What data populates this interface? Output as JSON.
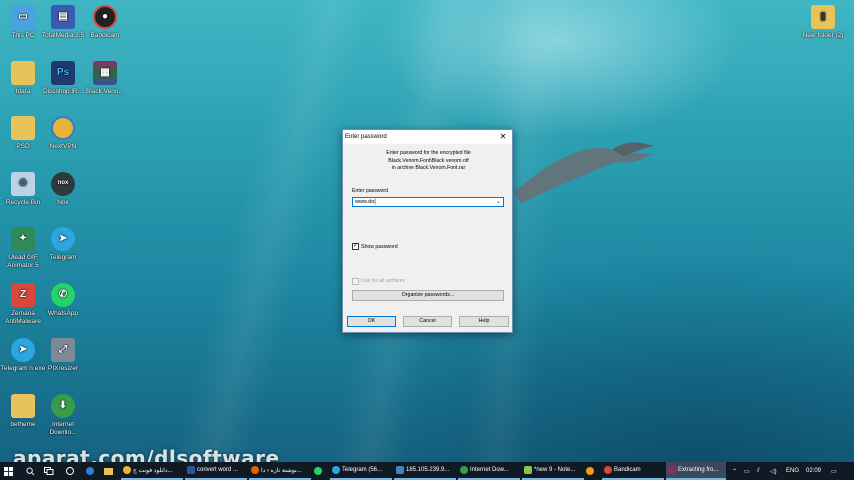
{
  "desktop": {
    "icons": [
      {
        "label": "This PC",
        "icon": "computer-icon",
        "color": "#4aa3df"
      },
      {
        "label": "TotalMedia 3.5",
        "icon": "totalmedia-icon",
        "color": "#3a5bb5"
      },
      {
        "label": "Bandicam",
        "icon": "bandicam-icon",
        "color": "#222222"
      },
      {
        "label": "tdata",
        "icon": "folder-icon",
        "color": "#e8c25a"
      },
      {
        "label": "Discshop.iR...",
        "icon": "photoshop-file-icon",
        "color": "#1e3a6e"
      },
      {
        "label": "Black.Veno...",
        "icon": "winrar-icon",
        "color": "#8a2c6e"
      },
      {
        "label": "PSD",
        "icon": "folder-icon",
        "color": "#e8c25a"
      },
      {
        "label": "NextVPN",
        "icon": "nextvpn-icon",
        "color": "#e7b43a"
      },
      {
        "label": "Recycle Bin",
        "icon": "recycle-bin-icon",
        "color": "#bcd3e6"
      },
      {
        "label": "Nox",
        "icon": "nox-icon",
        "color": "#2f3a3f"
      },
      {
        "label": "Ulead GIF Animator 5",
        "icon": "ulead-icon",
        "color": "#2e8b57"
      },
      {
        "label": "Telegram",
        "icon": "telegram-icon",
        "color": "#2ca5e0"
      },
      {
        "label": "Zemana AntiMalware",
        "icon": "zemana-icon",
        "color": "#d9463b"
      },
      {
        "label": "WhatsApp",
        "icon": "whatsapp-icon",
        "color": "#25d366"
      },
      {
        "label": "Telegram n.exe",
        "icon": "telegram-icon",
        "color": "#2ca5e0"
      },
      {
        "label": "PIXresizer",
        "icon": "pixresizer-icon",
        "color": "#7d8a96"
      },
      {
        "label": "betheme",
        "icon": "folder-icon",
        "color": "#e8c25a"
      },
      {
        "label": "Internet Downlo...",
        "icon": "internet-download-manager-icon",
        "color": "#3a9b4b"
      },
      {
        "label": "New folder (2)",
        "icon": "folder-zip-icon",
        "color": "#e8c25a"
      }
    ]
  },
  "dialog": {
    "title": "Enter password",
    "close_glyph": "✕",
    "message_line1": "Enter password for the encrypted file",
    "message_line2": "Black.Venom.Font\\Black venom.otf",
    "message_line3": "in archive Black.Venom.Font.rar",
    "password_label": "Enter password",
    "password_value": "www.do",
    "show_password_label": "Show password",
    "show_password_checked": "✓",
    "use_all_label": "Use for all archives",
    "organize_label": "Organize passwords...",
    "ok_label": "OK",
    "cancel_label": "Cancel",
    "help_label": "Help"
  },
  "watermark": "aparat.com/dlsoftware",
  "taskbar": {
    "items": [
      {
        "label": "دانلود فونت ج...",
        "icon": "chrome-icon",
        "color": "#e8b530"
      },
      {
        "label": "convert word ...",
        "icon": "word-icon",
        "color": "#2b579a"
      },
      {
        "label": "نوشتة تازه ‹ دا...",
        "icon": "firefox-icon",
        "color": "#e66000"
      },
      {
        "label": "Telegram (56...",
        "icon": "telegram-icon",
        "color": "#2ca5e0"
      },
      {
        "label": "185.105.239.9...",
        "icon": "remote-desktop-icon",
        "color": "#4a7fc1"
      },
      {
        "label": "Internet Dow...",
        "icon": "internet-download-manager-icon",
        "color": "#3a9b4b"
      },
      {
        "label": "*new 9 - Note...",
        "icon": "notepad-plus-icon",
        "color": "#8bc34a"
      },
      {
        "label": "Bandicam",
        "icon": "bandicam-icon",
        "color": "#d9463b"
      },
      {
        "label": "Extracting fro...",
        "icon": "winrar-icon",
        "color": "#8a2c6e"
      }
    ],
    "lang": "ENG",
    "time": "02:09"
  }
}
